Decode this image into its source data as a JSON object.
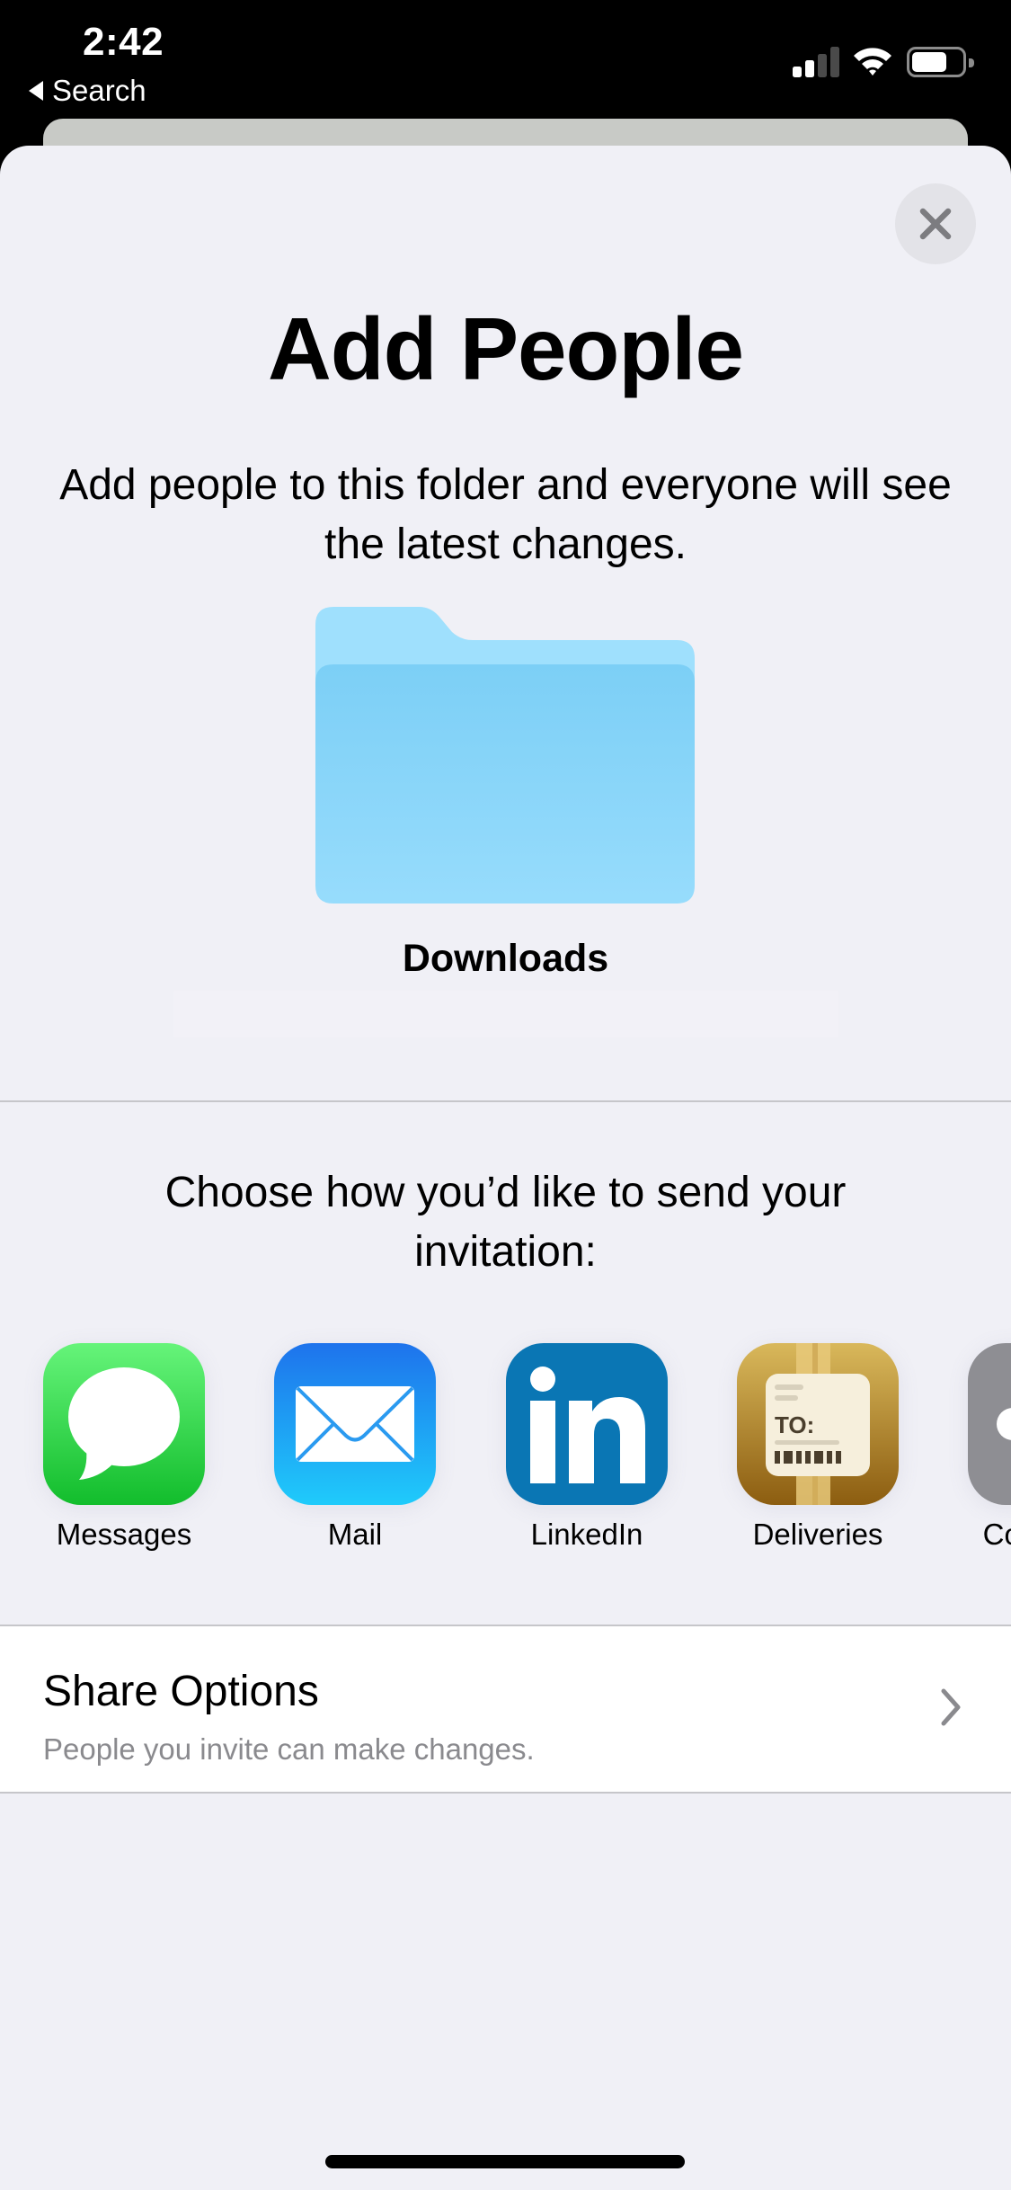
{
  "status_bar": {
    "time": "2:42",
    "back_label": "Search",
    "signal_bars_active": 2,
    "signal_bars_total": 4,
    "battery_level": 0.7
  },
  "sheet": {
    "close_icon": "close-icon",
    "title": "Add People",
    "subtitle": "Add people to this folder and everyone will see the latest changes.",
    "folder": {
      "icon": "folder-icon",
      "name": "Downloads",
      "color_back": "#9fe0fd",
      "color_front": "#84d2f7"
    },
    "choose_prompt": "Choose how you’d like to send your invitation:",
    "apps": [
      {
        "label": "Messages",
        "icon": "messages-icon",
        "color": "#34c759"
      },
      {
        "label": "Mail",
        "icon": "mail-icon",
        "color": "#1e8ff0"
      },
      {
        "label": "LinkedIn",
        "icon": "linkedin-icon",
        "color": "#0a76b4"
      },
      {
        "label": "Deliveries",
        "icon": "deliveries-icon",
        "color": "#b58a35"
      },
      {
        "label": "Copy Link",
        "icon": "copy-link-icon",
        "color": "#8e8e93"
      }
    ],
    "share_options": {
      "title": "Share Options",
      "subtitle": "People you invite can make changes.",
      "icon": "chevron-right-icon"
    }
  }
}
